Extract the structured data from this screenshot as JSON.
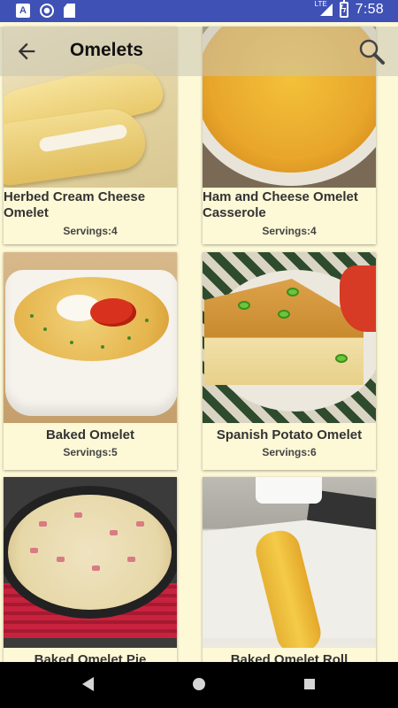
{
  "status_bar": {
    "icons": [
      "notification-a-icon",
      "sync-ring-icon",
      "sd-card-icon",
      "lte-signal-icon",
      "battery-charging-icon"
    ],
    "lte_label": "LTE",
    "time": "7:58",
    "background": "#3f51b5"
  },
  "toolbar": {
    "title": "Omelets",
    "back_icon": "arrow-back-icon",
    "search_icon": "search-icon"
  },
  "recipes": [
    {
      "title": "Herbed Cream Cheese Omelet",
      "servings": "Servings:4"
    },
    {
      "title": "Ham and Cheese Omelet Casserole",
      "servings": "Servings:4"
    },
    {
      "title": "Baked Omelet",
      "servings": "Servings:5"
    },
    {
      "title": "Spanish Potato Omelet",
      "servings": "Servings:6"
    },
    {
      "title": "Baked Omelet Pie",
      "servings": ""
    },
    {
      "title": "Baked Omelet Roll",
      "servings": ""
    }
  ],
  "nav_bar": {
    "buttons": [
      "back-triangle-icon",
      "home-circle-icon",
      "recents-square-icon"
    ]
  },
  "colors": {
    "card_background": "#fdf8d6",
    "page_background": "#fdf8d6"
  }
}
